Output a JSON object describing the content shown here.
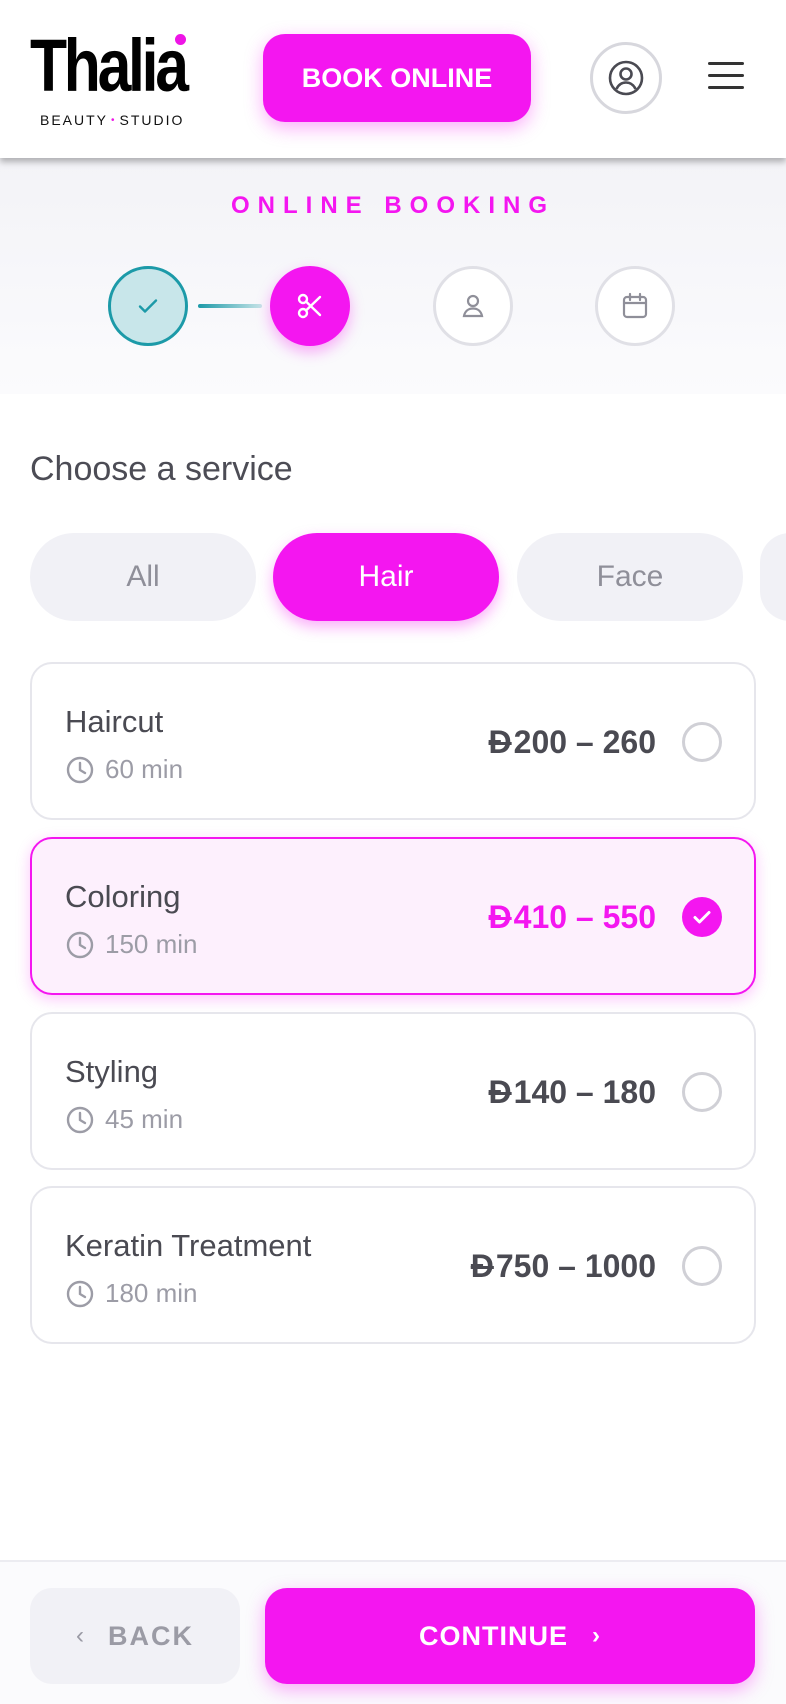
{
  "brand": {
    "name": "Thalia",
    "subtitle_left": "BEAUTY",
    "subtitle_sep": "•",
    "subtitle_right": "STUDIO",
    "accent": "#f416f0",
    "teal": "#1c9aa8"
  },
  "header": {
    "book_label": "BOOK ONLINE",
    "avatar_icon": "user-circle-icon",
    "menu_icon": "hamburger-menu-icon"
  },
  "booking": {
    "title": "ONLINE BOOKING",
    "steps": [
      {
        "icon": "check-icon",
        "state": "done"
      },
      {
        "icon": "scissors-icon",
        "state": "active"
      },
      {
        "icon": "person-icon",
        "state": "todo"
      },
      {
        "icon": "calendar-icon",
        "state": "todo"
      }
    ]
  },
  "services": {
    "title": "Choose a service",
    "filters": [
      "All",
      "Hair",
      "Face",
      ""
    ],
    "selected_filter": "Hair",
    "currency": "Đ",
    "items": [
      {
        "name": "Haircut",
        "duration": "60 min",
        "price": "200 – 260",
        "selected": false
      },
      {
        "name": "Coloring",
        "duration": "150 min",
        "price": "410 – 550",
        "selected": true
      },
      {
        "name": "Styling",
        "duration": "45 min",
        "price": "140 – 180",
        "selected": false
      },
      {
        "name": "Keratin Treatment",
        "duration": "180 min",
        "price": "750 – 1000",
        "selected": false
      }
    ]
  },
  "footer": {
    "back_label": "BACK",
    "continue_label": "CONTINUE"
  }
}
